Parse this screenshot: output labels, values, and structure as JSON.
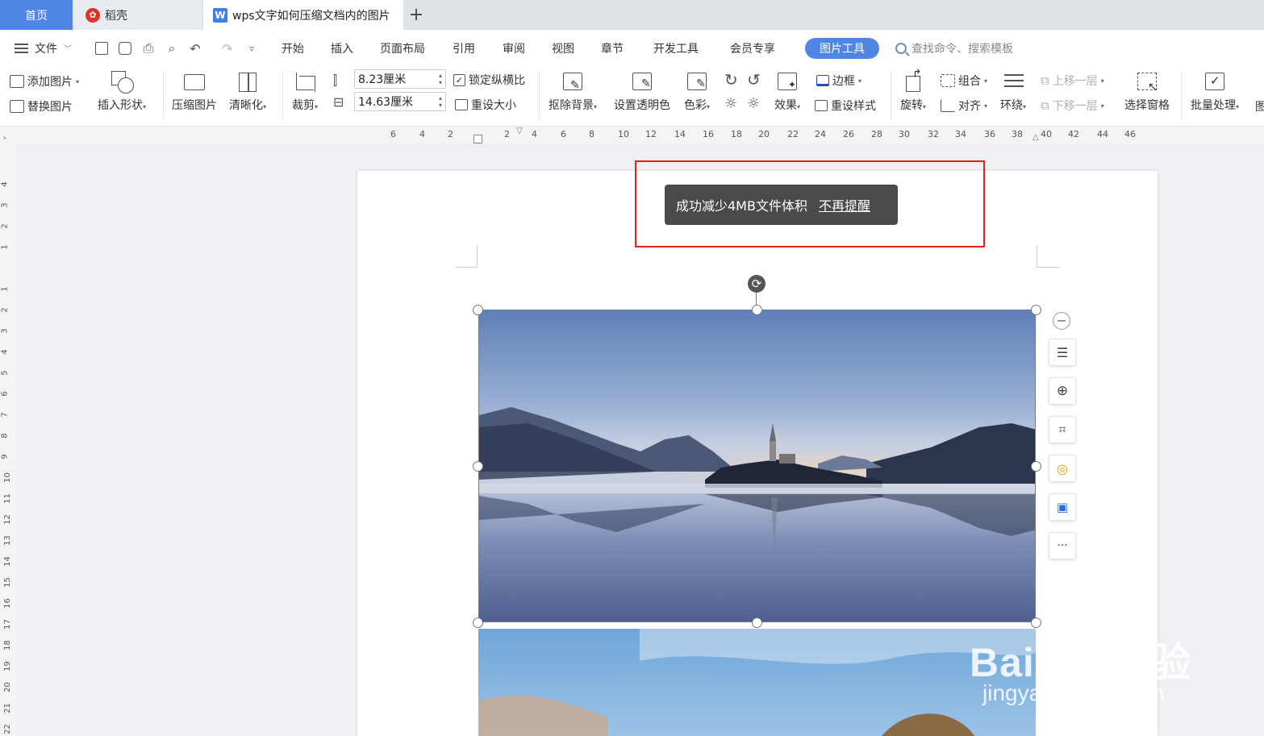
{
  "tabs": {
    "home": "首页",
    "daoke": "稻壳",
    "doc": "wps文字如何压缩文档内的图片",
    "doc_logo": "W",
    "add": "+"
  },
  "menu": {
    "file": "文件",
    "items": [
      "开始",
      "插入",
      "页面布局",
      "引用",
      "审阅",
      "视图",
      "章节",
      "开发工具",
      "会员专享"
    ],
    "active_tab": "图片工具",
    "search_placeholder": "查找命令、搜索模板"
  },
  "ribbon": {
    "add_picture": "添加图片",
    "replace_picture": "替换图片",
    "insert_shape": "插入形状",
    "compress_picture": "压缩图片",
    "sharpen": "清晰化",
    "crop": "裁剪",
    "height_value": "8.23厘米",
    "width_value": "14.63厘米",
    "lock_ratio": "锁定纵横比",
    "reset_size": "重设大小",
    "remove_bg": "抠除背景",
    "set_transparent": "设置透明色",
    "color": "色彩",
    "effects": "效果",
    "border": "边框",
    "reset_style": "重设样式",
    "rotate": "旋转",
    "group": "组合",
    "align": "对齐",
    "wrap": "环绕",
    "bring_forward": "上移一层",
    "send_backward": "下移一层",
    "selection_pane": "选择窗格",
    "batch": "批量处理",
    "more_cut": "图"
  },
  "ruler": {
    "h_labels": [
      "6",
      "4",
      "2",
      "2",
      "4",
      "6",
      "8",
      "10",
      "12",
      "14",
      "16",
      "18",
      "20",
      "22",
      "24",
      "26",
      "28",
      "30",
      "32",
      "34",
      "36",
      "38",
      "40",
      "42",
      "44",
      "46"
    ],
    "v_labels": [
      "4",
      "3",
      "2",
      "1",
      "1",
      "2",
      "3",
      "4",
      "5",
      "6",
      "7",
      "8",
      "9",
      "10",
      "11",
      "12",
      "13",
      "14",
      "15",
      "16",
      "17",
      "18",
      "19",
      "20",
      "21",
      "22"
    ]
  },
  "toast": {
    "message": "成功减少4MB文件体积",
    "dismiss": "不再提醒"
  },
  "side_toolbar": {
    "more": "···"
  },
  "watermark": {
    "brand": "Bai du 经验",
    "url": "jingyan.baidu.com"
  },
  "colors": {
    "accent": "#4f86e6",
    "highlight_border": "#d9251d",
    "toast_bg": "#4a4a4a"
  }
}
